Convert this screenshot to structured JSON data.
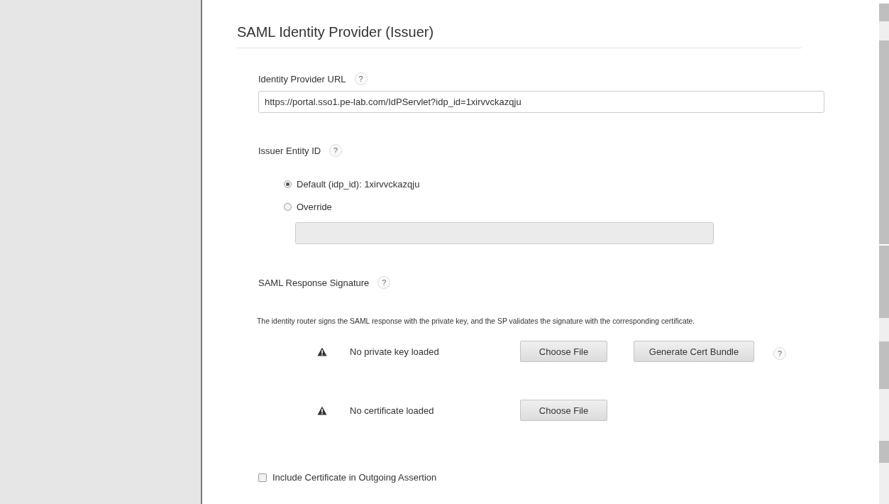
{
  "section": {
    "title": "SAML Identity Provider (Issuer)"
  },
  "idp_url": {
    "label": "Identity Provider URL",
    "help": "?",
    "value": "https://portal.sso1.pe-lab.com/IdPServlet?idp_id=1xirvvckazqju"
  },
  "issuer": {
    "label": "Issuer Entity ID",
    "help": "?",
    "options": [
      {
        "label": "Default (idp_id): 1xirvvckazqju",
        "selected": true
      },
      {
        "label": "Override",
        "selected": false
      }
    ],
    "override_field": {
      "disabled": true
    }
  },
  "signature": {
    "label": "SAML Response Signature",
    "help": "?",
    "description": "The identity router signs the SAML response with the private key, and the SP validates the signature with the corresponding certificate.",
    "rows": [
      {
        "status": "No private key loaded",
        "buttons": [
          "Choose File",
          "Generate Cert Bundle"
        ],
        "help": "?"
      },
      {
        "status": "No certificate loaded",
        "buttons": [
          "Choose File"
        ]
      }
    ]
  },
  "include_cert": {
    "label": "Include Certificate in Outgoing Assertion",
    "checked": false
  }
}
